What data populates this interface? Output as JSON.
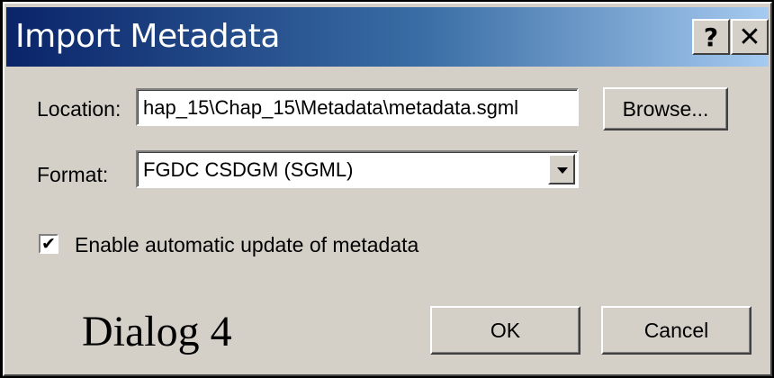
{
  "window": {
    "title": "Import Metadata"
  },
  "titlebar_buttons": {
    "help": "?",
    "close": "✕"
  },
  "location": {
    "label": "Location:",
    "value": "hap_15\\Chap_15\\Metadata\\metadata.sgml",
    "browse_label": "Browse..."
  },
  "format": {
    "label": "Format:",
    "selected": "FGDC CSDGM (SGML)"
  },
  "auto_update": {
    "checked": true,
    "checkmark": "✔",
    "label": "Enable automatic update of metadata"
  },
  "caption": "Dialog 4",
  "buttons": {
    "ok": "OK",
    "cancel": "Cancel"
  }
}
